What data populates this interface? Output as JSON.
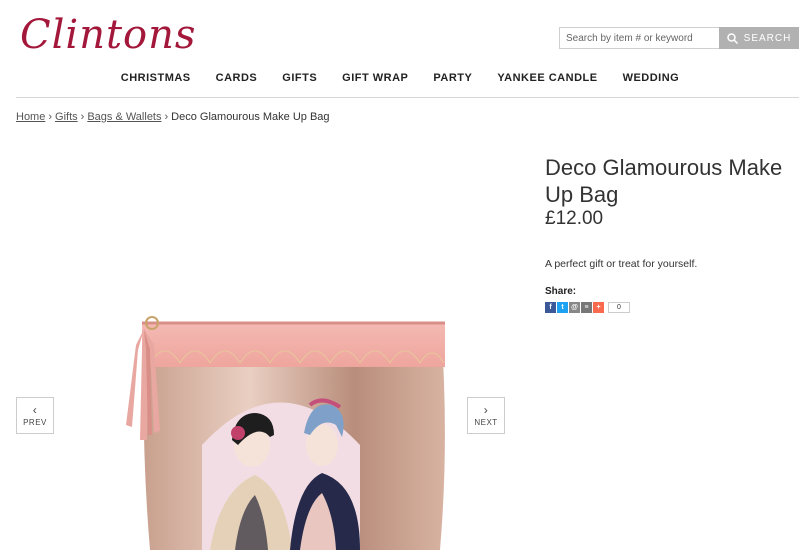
{
  "brand": {
    "logo_text": "Clintons",
    "color": "#a3183a"
  },
  "search": {
    "placeholder": "Search by item # or keyword",
    "button_label": "SEARCH"
  },
  "nav": {
    "items": [
      "CHRISTMAS",
      "CARDS",
      "GIFTS",
      "GIFT WRAP",
      "PARTY",
      "YANKEE CANDLE",
      "WEDDING"
    ]
  },
  "breadcrumb": {
    "home": "Home",
    "gifts": "Gifts",
    "bags": "Bags & Wallets",
    "current": "Deco Glamourous Make Up Bag",
    "sep": "›"
  },
  "product": {
    "title": "Deco Glamourous Make Up Bag",
    "price": "£12.00",
    "description": "A perfect gift or treat for yourself.",
    "share_label": "Share:",
    "share_count": "0",
    "share_buttons": [
      {
        "name": "facebook",
        "glyph": "f",
        "color": "#3b5998"
      },
      {
        "name": "twitter",
        "glyph": "t",
        "color": "#1da1f2"
      },
      {
        "name": "email",
        "glyph": "@",
        "color": "#888888"
      },
      {
        "name": "print",
        "glyph": "≡",
        "color": "#777777"
      },
      {
        "name": "addthis",
        "glyph": "+",
        "color": "#f8694d"
      }
    ]
  },
  "carousel": {
    "prev_label": "PREV",
    "next_label": "NEXT"
  }
}
